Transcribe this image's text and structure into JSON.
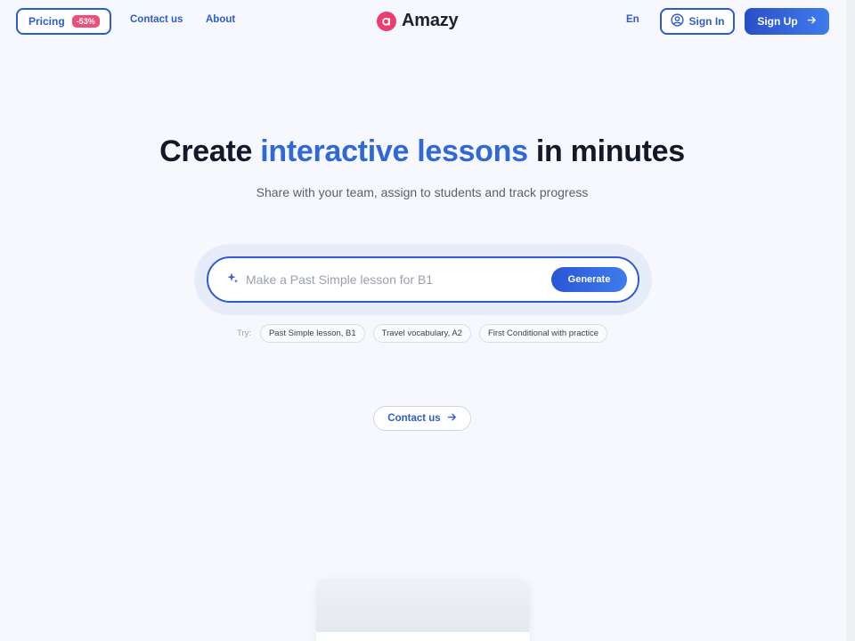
{
  "header": {
    "pricing_label": "Pricing",
    "pricing_badge": "-53%",
    "contact_label": "Contact us",
    "about_label": "About",
    "logo_text": "Amazy",
    "language": "En",
    "signin_label": "Sign In",
    "signup_label": "Sign Up"
  },
  "hero": {
    "title_part1": "Create ",
    "title_accent": "interactive lessons",
    "title_part2": " in minutes",
    "subtitle": "Share with your team, assign to students and track progress"
  },
  "search": {
    "placeholder": "Make a Past Simple lesson for B1",
    "value": "",
    "generate_label": "Generate"
  },
  "suggestions": {
    "try_label": "Try:",
    "chips": [
      "Past Simple lesson, B1",
      "Travel vocabulary, A2",
      "First Conditional with practice"
    ]
  },
  "cta": {
    "contact_label": "Contact us"
  },
  "colors": {
    "primary": "#2f5bd0",
    "accent_text": "#3068d8",
    "brand_pink": "#ea3e6f",
    "badge": "#ec4f7a",
    "background": "#f6f8fd"
  },
  "icons": [
    "logo-icon",
    "user-circle-icon",
    "arrow-right-icon",
    "sparkle-icon"
  ]
}
